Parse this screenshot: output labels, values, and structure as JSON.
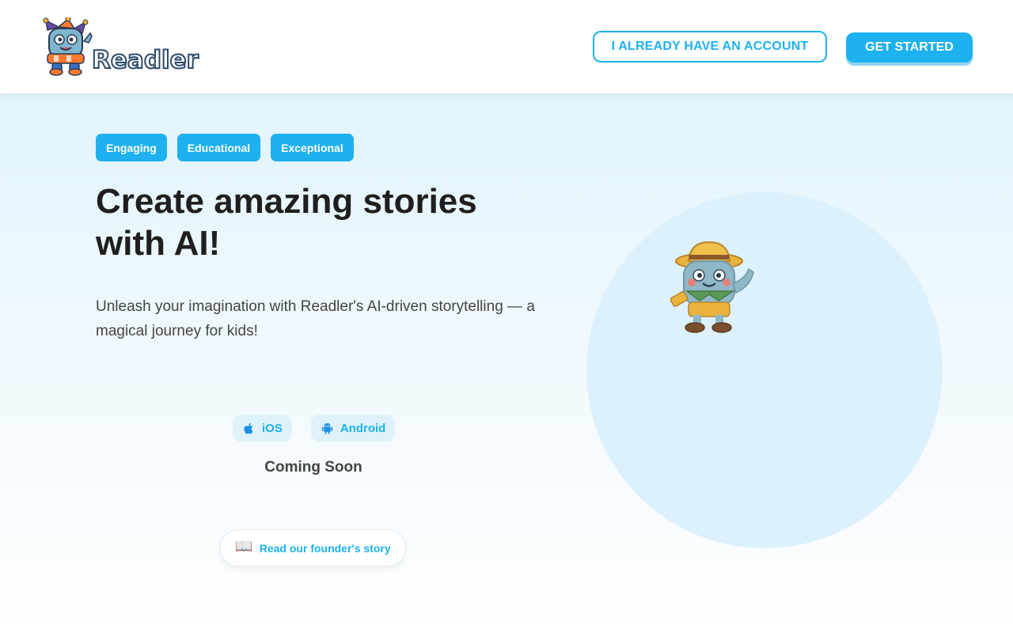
{
  "brand": {
    "name": "Readler"
  },
  "header": {
    "account_label": "I ALREADY HAVE AN ACCOUNT",
    "start_label": "GET STARTED"
  },
  "hero": {
    "tags": [
      "Engaging",
      "Educational",
      "Exceptional"
    ],
    "headline": "Create amazing stories with AI!",
    "subtext": "Unleash your imagination with Readler's AI-driven storytelling — a magical journey for kids!",
    "stores": [
      {
        "label": "iOS",
        "icon": "apple-icon"
      },
      {
        "label": "Android",
        "icon": "android-icon"
      }
    ],
    "coming_soon": "Coming Soon",
    "founder_link": "Read our founder's story",
    "founder_icon": "📖"
  },
  "colors": {
    "accent": "#1db1ef",
    "headline": "#1f1f1f",
    "body_text": "#444444",
    "circle": "#dcf1fc"
  }
}
